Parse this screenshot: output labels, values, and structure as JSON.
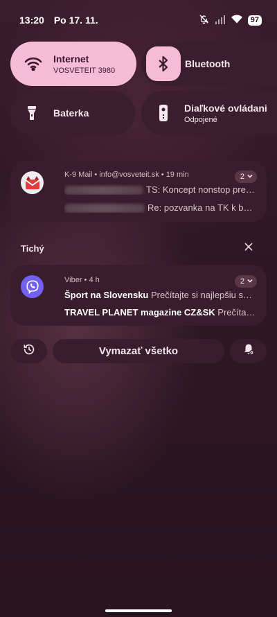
{
  "status_bar": {
    "time": "13:20",
    "date": "Po 17. 11.",
    "battery": "97",
    "icons": [
      "mute-icon",
      "signal-icon",
      "wifi-icon",
      "battery-icon"
    ]
  },
  "quick_tiles": [
    {
      "id": "internet",
      "title": "Internet",
      "subtitle": "VOSVETEIT 3980",
      "icon": "wifi-icon",
      "active": true
    },
    {
      "id": "bluetooth",
      "title": "Bluetooth",
      "icon": "bluetooth-icon",
      "active": true
    },
    {
      "id": "flashlight",
      "title": "Baterka",
      "icon": "flashlight-icon",
      "active": false
    },
    {
      "id": "remote",
      "title": "Diaľkové ovládani",
      "subtitle": "Odpojené",
      "icon": "remote-icon",
      "active": false
    }
  ],
  "notifications": [
    {
      "app": "K-9 Mail",
      "account": "info@vosveteit.sk",
      "time": "19 min",
      "count": "2",
      "lines": [
        {
          "visible_text": "TS: Koncept nonstop pred..."
        },
        {
          "visible_text": "Re: pozvanka na TK k bezho..."
        }
      ]
    }
  ],
  "silent_section": {
    "title": "Tichý",
    "notifications": [
      {
        "app": "Viber",
        "time": "4 h",
        "count": "2",
        "lines": [
          {
            "sender": "Šport na Slovensku",
            "text": "Prečítajte si najlepšiu sprá..."
          },
          {
            "sender": "TRAVEL PLANET magazine CZ&SK",
            "text": "Prečítajte s..."
          }
        ]
      }
    ]
  },
  "actions": {
    "clear_all": "Vymazať všetko"
  },
  "colors": {
    "tile_active": "#f6bcd6",
    "card": "#3a1d2c",
    "viber": "#7360f2",
    "k9_red": "#e23b3b"
  }
}
